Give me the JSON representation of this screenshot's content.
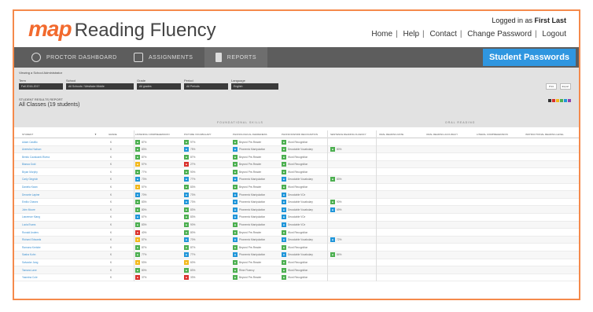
{
  "header": {
    "logo_map": "map",
    "logo_title": "Reading Fluency",
    "logged_prefix": "Logged in as",
    "logged_user": "First Last",
    "links": [
      "Home",
      "Help",
      "Contact",
      "Change Password",
      "Logout"
    ]
  },
  "nav": {
    "items": [
      {
        "label": "PROCTOR DASHBOARD",
        "icon": "dashboard-icon"
      },
      {
        "label": "ASSIGNMENTS",
        "icon": "assignments-icon"
      },
      {
        "label": "REPORTS",
        "icon": "reports-icon"
      }
    ],
    "active_item": "REPORTS",
    "student_passwords": "Student Passwords"
  },
  "colors": {
    "brand_orange": "#f26a2e",
    "nav_bg": "#5d5d5d",
    "accent_blue": "#2f96e0",
    "green": "#4caf50",
    "blue": "#2196d9",
    "yellow": "#f2b81c",
    "red": "#d9302b"
  },
  "filters": {
    "title": "Viewing a School Administrator",
    "labels": [
      "Term",
      "School",
      "Grade",
      "Period",
      "Language"
    ],
    "values": [
      "Fall 2016-2017",
      "All Schools / Westlake Middle",
      "All grades",
      "All Periods",
      "English"
    ],
    "buttons": [
      "Print",
      "Export"
    ]
  },
  "section": {
    "title": "STUDENT RESULTS REPORT",
    "subtitle": "All Classes (19 students)"
  },
  "groups": {
    "foundational": "FOUNDATIONAL SKILLS",
    "oral": "ORAL READING"
  },
  "columns": [
    "STUDENT",
    "GRADE",
    "LISTENING COMPREHENSION",
    "PICTURE VOCABULARY",
    "PHONOLOGICAL AWARENESS",
    "PHONICS/WORD RECOGNITION",
    "SENTENCE READING FLUENCY",
    "ORAL READING RATE",
    "ORAL READING ACCURACY",
    "LITERAL COMPREHENSION",
    "INSTRUCTIONAL READING LEVEL"
  ],
  "rows": [
    {
      "name": "Adam Castillo",
      "grade": "K",
      "lc": [
        "G",
        "87%"
      ],
      "pv": [
        "G",
        "97%"
      ],
      "pa": [
        "G",
        "Beyond Pre-Reader"
      ],
      "ph": [
        "G",
        "Word Recognition"
      ],
      "srf": null
    },
    {
      "name": "Aneesha Hudson",
      "grade": "K",
      "lc": [
        "G",
        "83%"
      ],
      "pv": [
        "B",
        "75%"
      ],
      "pa": [
        "B",
        "Phonemic Manipulation"
      ],
      "ph": [
        "G",
        "Decodable Vocabulary"
      ],
      "srf": [
        "G",
        "80%"
      ]
    },
    {
      "name": "Benito Cavalcanti-Rivera",
      "grade": "K",
      "lc": [
        "G",
        "87%"
      ],
      "pv": [
        "G",
        "87%"
      ],
      "pa": [
        "G",
        "Beyond Pre-Reader"
      ],
      "ph": [
        "G",
        "Word Recognition"
      ],
      "srf": null
    },
    {
      "name": "Bianca Gold",
      "grade": "K",
      "lc": [
        "Y",
        "57%"
      ],
      "pv": [
        "R",
        "27%"
      ],
      "pa": [
        "G",
        "Beyond Pre-Reader"
      ],
      "ph": [
        "G",
        "Word Recognition"
      ],
      "srf": null
    },
    {
      "name": "Bryan Murphy",
      "grade": "K",
      "lc": [
        "G",
        "77%"
      ],
      "pv": [
        "G",
        "90%"
      ],
      "pa": [
        "G",
        "Beyond Pre-Reader"
      ],
      "ph": [
        "G",
        "Word Recognition"
      ],
      "srf": null
    },
    {
      "name": "Carly Gingrich",
      "grade": "K",
      "lc": [
        "B",
        "73%"
      ],
      "pv": [
        "B",
        "77%"
      ],
      "pa": [
        "B",
        "Phonemic Manipulation"
      ],
      "ph": [
        "B",
        "Decodable Vocabulary"
      ],
      "srf": [
        "G",
        "83%"
      ]
    },
    {
      "name": "Daniela Kwan",
      "grade": "K",
      "lc": [
        "Y",
        "57%"
      ],
      "pv": [
        "G",
        "83%"
      ],
      "pa": [
        "G",
        "Beyond Pre-Reader"
      ],
      "ph": [
        "G",
        "Word Recognition"
      ],
      "srf": null
    },
    {
      "name": "Devonte Lapine",
      "grade": "K",
      "lc": [
        "B",
        "70%"
      ],
      "pv": [
        "B",
        "73%"
      ],
      "pa": [
        "B",
        "Phonemic Manipulation"
      ],
      "ph": [
        "B",
        "Decodable VCe"
      ],
      "srf": null
    },
    {
      "name": "Emilio Chavez",
      "grade": "K",
      "lc": [
        "G",
        "83%"
      ],
      "pv": [
        "B",
        "73%"
      ],
      "pa": [
        "B",
        "Phonemic Manipulation"
      ],
      "ph": [
        "B",
        "Decodable Vocabulary"
      ],
      "srf": [
        "G",
        "90%"
      ]
    },
    {
      "name": "John Moore",
      "grade": "K",
      "lc": [
        "G",
        "80%"
      ],
      "pv": [
        "G",
        "83%"
      ],
      "pa": [
        "B",
        "Phonemic Manipulation"
      ],
      "ph": [
        "B",
        "Decodable Vocabulary"
      ],
      "srf": [
        "B",
        "69%"
      ]
    },
    {
      "name": "Lawrence Kiang",
      "grade": "K",
      "lc": [
        "B",
        "67%"
      ],
      "pv": [
        "G",
        "83%"
      ],
      "pa": [
        "B",
        "Phonemic Manipulation"
      ],
      "ph": [
        "B",
        "Decodable VCe"
      ],
      "srf": null
    },
    {
      "name": "Lucia Evans",
      "grade": "K",
      "lc": [
        "G",
        "83%"
      ],
      "pv": [
        "G",
        "90%"
      ],
      "pa": [
        "G",
        "Phonemic Manipulation"
      ],
      "ph": [
        "B",
        "Decodable VCe"
      ],
      "srf": null
    },
    {
      "name": "Ronald Anders",
      "grade": "K",
      "lc": [
        "R",
        "40%"
      ],
      "pv": [
        "G",
        "80%"
      ],
      "pa": [
        "G",
        "Beyond Pre-Reader"
      ],
      "ph": [
        "G",
        "Word Recognition"
      ],
      "srf": null
    },
    {
      "name": "Richard Edwards",
      "grade": "K",
      "lc": [
        "Y",
        "57%"
      ],
      "pv": [
        "B",
        "70%"
      ],
      "pa": [
        "B",
        "Phonemic Manipulation"
      ],
      "ph": [
        "B",
        "Decodable Vocabulary"
      ],
      "srf": [
        "B",
        "72%"
      ]
    },
    {
      "name": "Ramona Kreisler",
      "grade": "K",
      "lc": [
        "G",
        "87%"
      ],
      "pv": [
        "G",
        "87%"
      ],
      "pa": [
        "G",
        "Beyond Pre-Reader"
      ],
      "ph": [
        "G",
        "Word Recognition"
      ],
      "srf": null
    },
    {
      "name": "Sasha Kuhn",
      "grade": "K",
      "lc": [
        "G",
        "77%"
      ],
      "pv": [
        "B",
        "77%"
      ],
      "pa": [
        "B",
        "Phonemic Manipulation"
      ],
      "ph": [
        "B",
        "Decodable Vocabulary"
      ],
      "srf": [
        "G",
        "84%"
      ]
    },
    {
      "name": "Salvador Jang",
      "grade": "K",
      "lc": [
        "Y",
        "53%"
      ],
      "pv": [
        "Y",
        "60%"
      ],
      "pa": [
        "G",
        "Beyond Pre-Reader"
      ],
      "ph": [
        "G",
        "Word Recognition"
      ],
      "srf": null
    },
    {
      "name": "Tamara Lane",
      "grade": "K",
      "lc": [
        "G",
        "80%"
      ],
      "pv": [
        "G",
        "83%"
      ],
      "pa": [
        "G",
        "Rime Fluency"
      ],
      "ph": [
        "G",
        "Word Recognition"
      ],
      "srf": null
    },
    {
      "name": "Yasmina Cole",
      "grade": "K",
      "lc": [
        "R",
        "37%"
      ],
      "pv": [
        "R",
        "33%"
      ],
      "pa": [
        "G",
        "Beyond Pre-Reader"
      ],
      "ph": [
        "G",
        "Word Recognition"
      ],
      "srf": null
    }
  ]
}
